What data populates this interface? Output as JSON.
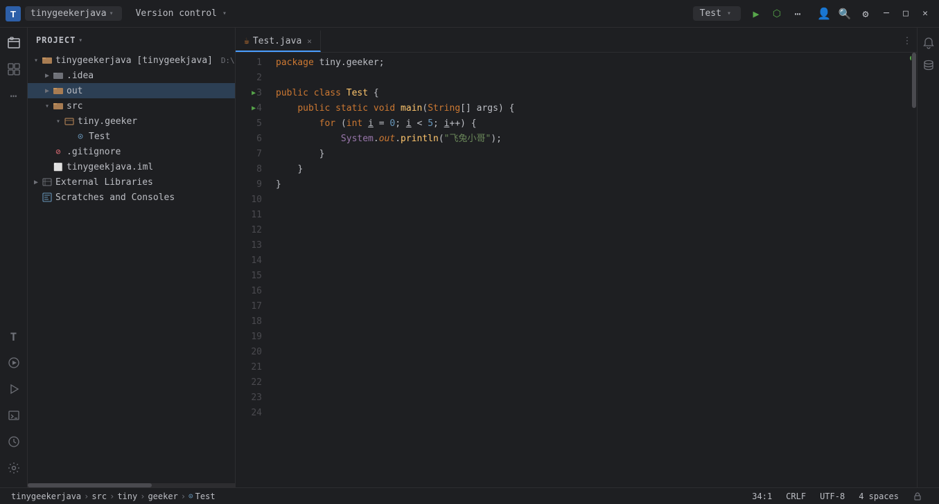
{
  "titlebar": {
    "logo": "T",
    "project_label": "tinygeekerjava",
    "project_arrow": "▾",
    "version_control": "Version control",
    "version_control_arrow": "▾",
    "run_config": "Test",
    "run_config_arrow": "▾",
    "run_btn": "▶",
    "debug_btn": "🐛",
    "profile_btn": "◉",
    "more_btn": "⋯",
    "search_btn": "🔍",
    "settings_btn": "⚙",
    "user_btn": "👤",
    "minimize": "─",
    "maximize": "□",
    "close": "✕"
  },
  "sidebar": {
    "header": "Project",
    "header_arrow": "▾",
    "items": [
      {
        "id": "root",
        "label": "tinygeekerjava [tinygeekjava]",
        "path": "D:\\tinyge...",
        "depth": 0,
        "arrow": "▾",
        "icon": "folder",
        "expanded": true
      },
      {
        "id": "idea",
        "label": ".idea",
        "depth": 1,
        "arrow": "▶",
        "icon": "folder",
        "expanded": false
      },
      {
        "id": "out",
        "label": "out",
        "depth": 1,
        "arrow": "▶",
        "icon": "folder",
        "expanded": false,
        "selected": true
      },
      {
        "id": "src",
        "label": "src",
        "depth": 1,
        "arrow": "▾",
        "icon": "folder",
        "expanded": true
      },
      {
        "id": "tiny.geeker",
        "label": "tiny.geeker",
        "depth": 2,
        "arrow": "▾",
        "icon": "package",
        "expanded": true
      },
      {
        "id": "Test",
        "label": "Test",
        "depth": 3,
        "arrow": "",
        "icon": "java",
        "expanded": false
      },
      {
        "id": "gitignore",
        "label": ".gitignore",
        "depth": 1,
        "arrow": "",
        "icon": "gitignore",
        "expanded": false
      },
      {
        "id": "iml",
        "label": "tinygeekjava.iml",
        "depth": 1,
        "arrow": "",
        "icon": "iml",
        "expanded": false
      },
      {
        "id": "ext-lib",
        "label": "External Libraries",
        "depth": 0,
        "arrow": "▶",
        "icon": "ext-lib",
        "expanded": false
      },
      {
        "id": "scratches",
        "label": "Scratches and Consoles",
        "depth": 0,
        "arrow": "",
        "icon": "scratches",
        "expanded": false
      }
    ]
  },
  "editor": {
    "tab_label": "Test.java",
    "tab_icon": "☕",
    "lines": [
      {
        "num": 1,
        "content": "package tiny.geeker;"
      },
      {
        "num": 2,
        "content": ""
      },
      {
        "num": 3,
        "content": "public class Test {",
        "has_run": true
      },
      {
        "num": 4,
        "content": "    public static void main(String[] args) {",
        "has_run": true
      },
      {
        "num": 5,
        "content": "        for (int i = 0; i < 5; i++) {"
      },
      {
        "num": 6,
        "content": "            System.out.println(\"飞兔小哥\");"
      },
      {
        "num": 7,
        "content": "        }"
      },
      {
        "num": 8,
        "content": "    }"
      },
      {
        "num": 9,
        "content": "}"
      },
      {
        "num": 10,
        "content": ""
      },
      {
        "num": 11,
        "content": ""
      },
      {
        "num": 12,
        "content": ""
      },
      {
        "num": 13,
        "content": ""
      },
      {
        "num": 14,
        "content": ""
      },
      {
        "num": 15,
        "content": ""
      },
      {
        "num": 16,
        "content": ""
      },
      {
        "num": 17,
        "content": ""
      },
      {
        "num": 18,
        "content": ""
      },
      {
        "num": 19,
        "content": ""
      },
      {
        "num": 20,
        "content": ""
      },
      {
        "num": 21,
        "content": ""
      },
      {
        "num": 22,
        "content": ""
      },
      {
        "num": 23,
        "content": ""
      },
      {
        "num": 24,
        "content": ""
      }
    ]
  },
  "status_bar": {
    "breadcrumb": [
      "tinygeekerjava",
      "src",
      "tiny",
      "geeker",
      "Test"
    ],
    "position": "34:1",
    "line_ending": "CRLF",
    "encoding": "UTF-8",
    "indent": "4 spaces",
    "lock_icon": "🔒"
  },
  "activity_bar": {
    "icons": [
      {
        "id": "project",
        "symbol": "📁",
        "active": true
      },
      {
        "id": "plugins",
        "symbol": "⊞"
      },
      {
        "id": "more",
        "symbol": "⋯"
      }
    ],
    "bottom_icons": [
      {
        "id": "t-icon",
        "symbol": "T"
      },
      {
        "id": "learn",
        "symbol": "▶"
      },
      {
        "id": "play",
        "symbol": "▷"
      },
      {
        "id": "terminal",
        "symbol": "⊡"
      },
      {
        "id": "history",
        "symbol": "⊙"
      },
      {
        "id": "settings",
        "symbol": "⚙"
      }
    ]
  }
}
